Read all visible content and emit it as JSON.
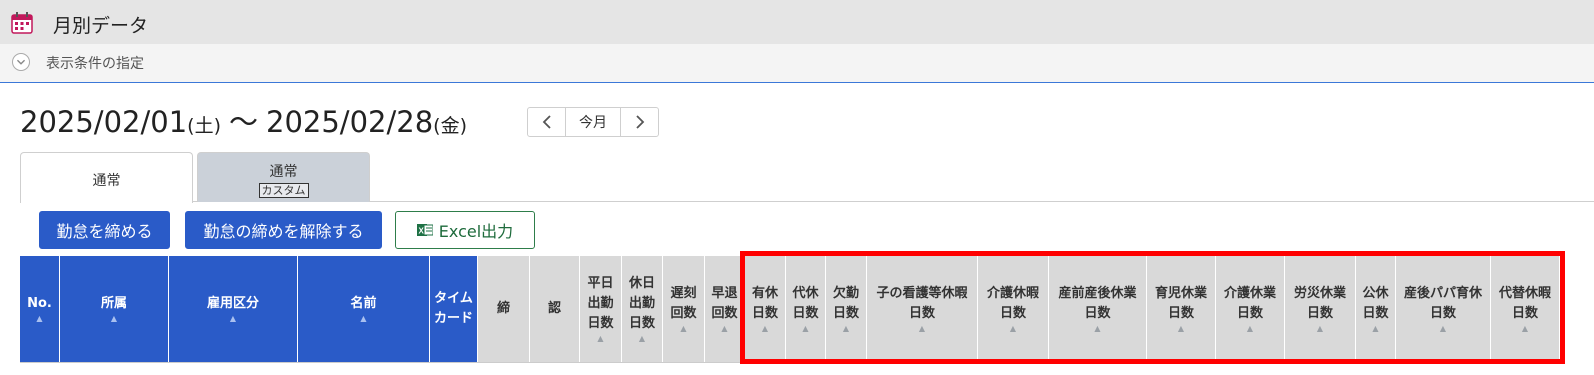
{
  "header": {
    "title": "月別データ",
    "icon": "calendar-icon"
  },
  "conditions": {
    "label": "表示条件の指定",
    "icon": "chevron-down-icon"
  },
  "date_range": {
    "start": "2025/02/01",
    "start_dow": "(土)",
    "separator": "〜",
    "end": "2025/02/28",
    "end_dow": "(金)"
  },
  "nav": {
    "prev_icon": "chevron-left-icon",
    "current_label": "今月",
    "next_icon": "chevron-right-icon"
  },
  "tabs": [
    {
      "label": "通常",
      "badge": "",
      "active": true
    },
    {
      "label": "通常",
      "badge": "カスタム",
      "active": false
    }
  ],
  "actions": {
    "close_label": "勤怠を締める",
    "unclose_label": "勤怠の締めを解除する",
    "excel_label": "Excel出力"
  },
  "colors": {
    "accent": "#2a5bc8",
    "highlight": "#ff0000"
  },
  "table": {
    "columns": [
      {
        "line1": "No.",
        "line2": "",
        "line3": "",
        "style": "blue",
        "sort": true
      },
      {
        "line1": "所属",
        "line2": "",
        "line3": "",
        "style": "blue",
        "sort": true
      },
      {
        "line1": "雇用区分",
        "line2": "",
        "line3": "",
        "style": "blue",
        "sort": true
      },
      {
        "line1": "名前",
        "line2": "",
        "line3": "",
        "style": "blue",
        "sort": true
      },
      {
        "line1": "タイム",
        "line2": "カード",
        "line3": "",
        "style": "blue",
        "sort": false
      },
      {
        "line1": "締",
        "line2": "",
        "line3": "",
        "style": "gray",
        "sort": false
      },
      {
        "line1": "認",
        "line2": "",
        "line3": "",
        "style": "gray",
        "sort": false
      },
      {
        "line1": "平日",
        "line2": "出勤",
        "line3": "日数",
        "style": "gray",
        "sort": true
      },
      {
        "line1": "休日",
        "line2": "出勤",
        "line3": "日数",
        "style": "gray",
        "sort": true
      },
      {
        "line1": "遅刻",
        "line2": "回数",
        "line3": "",
        "style": "gray",
        "sort": true
      },
      {
        "line1": "早退",
        "line2": "回数",
        "line3": "",
        "style": "gray",
        "sort": true
      },
      {
        "line1": "有休",
        "line2": "日数",
        "line3": "",
        "style": "gray",
        "sort": true
      },
      {
        "line1": "代休",
        "line2": "日数",
        "line3": "",
        "style": "gray",
        "sort": true
      },
      {
        "line1": "欠勤",
        "line2": "日数",
        "line3": "",
        "style": "gray",
        "sort": true
      },
      {
        "line1": "子の看護等休暇",
        "line2": "日数",
        "line3": "",
        "style": "gray",
        "sort": true
      },
      {
        "line1": "介護休暇",
        "line2": "日数",
        "line3": "",
        "style": "gray",
        "sort": true
      },
      {
        "line1": "産前産後休業",
        "line2": "日数",
        "line3": "",
        "style": "gray",
        "sort": true
      },
      {
        "line1": "育児休業",
        "line2": "日数",
        "line3": "",
        "style": "gray",
        "sort": true
      },
      {
        "line1": "介護休業",
        "line2": "日数",
        "line3": "",
        "style": "gray",
        "sort": true
      },
      {
        "line1": "労災休業",
        "line2": "日数",
        "line3": "",
        "style": "gray",
        "sort": true
      },
      {
        "line1": "公休",
        "line2": "日数",
        "line3": "",
        "style": "gray",
        "sort": true
      },
      {
        "line1": "産後パパ育休",
        "line2": "日数",
        "line3": "",
        "style": "gray",
        "sort": true
      },
      {
        "line1": "代替休暇",
        "line2": "日数",
        "line3": "",
        "style": "gray",
        "sort": true
      }
    ]
  }
}
